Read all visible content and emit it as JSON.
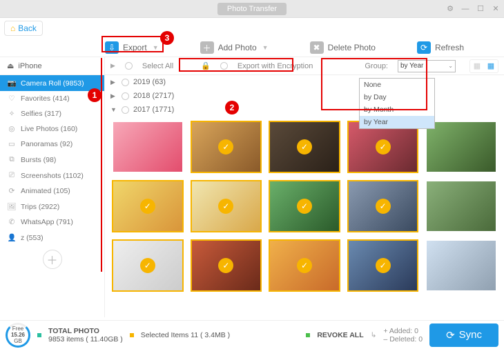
{
  "title": "Photo Transfer",
  "back_label": "Back",
  "toolbar": {
    "export": "Export",
    "add_photo": "Add Photo",
    "delete_photo": "Delete Photo",
    "refresh": "Refresh"
  },
  "device": "iPhone",
  "sidebar": [
    {
      "icon": "📷",
      "label": "Camera Roll (9853)",
      "active": true
    },
    {
      "icon": "♡",
      "label": "Favorites (414)"
    },
    {
      "icon": "✧",
      "label": "Selfies (317)"
    },
    {
      "icon": "◎",
      "label": "Live Photos (160)"
    },
    {
      "icon": "▭",
      "label": "Panoramas (92)"
    },
    {
      "icon": "⧉",
      "label": "Bursts (98)"
    },
    {
      "icon": "⎚",
      "label": "Screenshots (1102)"
    },
    {
      "icon": "⟳",
      "label": "Animated (105)"
    },
    {
      "icon": "🖼",
      "label": "Trips (2922)"
    },
    {
      "icon": "✆",
      "label": "WhatsApp (791)"
    },
    {
      "icon": "👤",
      "label": "z (553)"
    }
  ],
  "filter": {
    "select_all": "Select All",
    "export_encryption": "Export with Encryption",
    "group_label": "Group:",
    "group_value": "by Year",
    "group_options": [
      "None",
      "by Day",
      "by Month",
      "by Year"
    ]
  },
  "years": [
    {
      "arrow": "▶",
      "label": "2019 (63)"
    },
    {
      "arrow": "▶",
      "label": "2018 (2717)"
    },
    {
      "arrow": "▼",
      "label": "2017 (1771)"
    }
  ],
  "footer": {
    "free_top": "Free",
    "free_val": "15.26",
    "free_unit": "GB",
    "total_label": "TOTAL PHOTO",
    "total_line": "9853 items ( 11.40GB )",
    "selected": "Selected Items 11 ( 3.4MB )",
    "revoke": "REVOKE ALL",
    "added": "Added: 0",
    "deleted": "Deleted: 0",
    "sync": "Sync"
  },
  "annotations": {
    "b1": "1",
    "b2": "2",
    "b3": "3"
  }
}
